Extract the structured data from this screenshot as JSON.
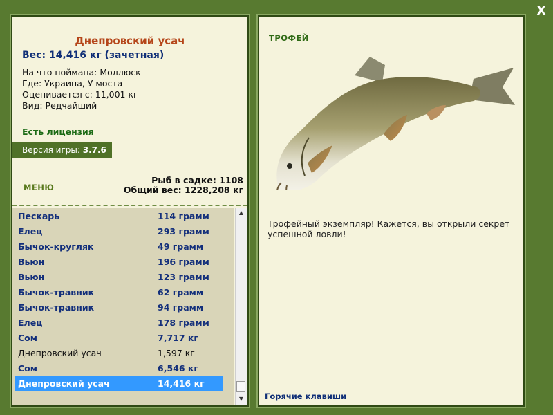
{
  "close_label": "X",
  "fish": {
    "title": "Днепровский усач",
    "weight": "Вес: 14,416 кг (зачетная)",
    "caught_on": "На что поймана: Моллюск",
    "location": "Где: Украина, У моста",
    "valued_from": "Оценивается с: 11,001 кг",
    "kind": "Вид: Редчайший"
  },
  "license": "Есть лицензия",
  "version": {
    "label": "Версия игры:",
    "value": "3.7.6"
  },
  "menu_label": "МЕНЮ",
  "stats": {
    "fish_count": "Рыб в садке: 1108",
    "total_weight": "Общий вес: 1228,208 кг"
  },
  "catch_list": [
    {
      "name": "Пескарь",
      "weight": "114 грамм",
      "style": "bold"
    },
    {
      "name": "Елец",
      "weight": "293 грамм",
      "style": "bold"
    },
    {
      "name": "Бычок-кругляк",
      "weight": "49 грамм",
      "style": "bold"
    },
    {
      "name": "Вьюн",
      "weight": "196 грамм",
      "style": "bold"
    },
    {
      "name": "Вьюн",
      "weight": "123 грамм",
      "style": "bold"
    },
    {
      "name": "Бычок-травник",
      "weight": "62 грамм",
      "style": "bold"
    },
    {
      "name": "Бычок-травник",
      "weight": "94 грамм",
      "style": "bold"
    },
    {
      "name": "Елец",
      "weight": "178 грамм",
      "style": "bold"
    },
    {
      "name": "Сом",
      "weight": "7,717 кг",
      "style": "bold"
    },
    {
      "name": "Днепровский усач",
      "weight": "1,597 кг",
      "style": "normal"
    },
    {
      "name": "Сом",
      "weight": "6,546 кг",
      "style": "bold"
    },
    {
      "name": "Днепровский усач",
      "weight": "14,416 кг",
      "style": "selected"
    }
  ],
  "trophy_label": "ТРОФЕЙ",
  "trophy_text": "Трофейный экземпляр! Кажется, вы открыли секрет успешной ловли!",
  "hotkeys_label": "Горячие клавиши",
  "colors": {
    "frame": "#587a30",
    "panel": "#f5f3dc",
    "selection": "#3399ff",
    "title": "#b5461a",
    "link": "#102f77"
  }
}
